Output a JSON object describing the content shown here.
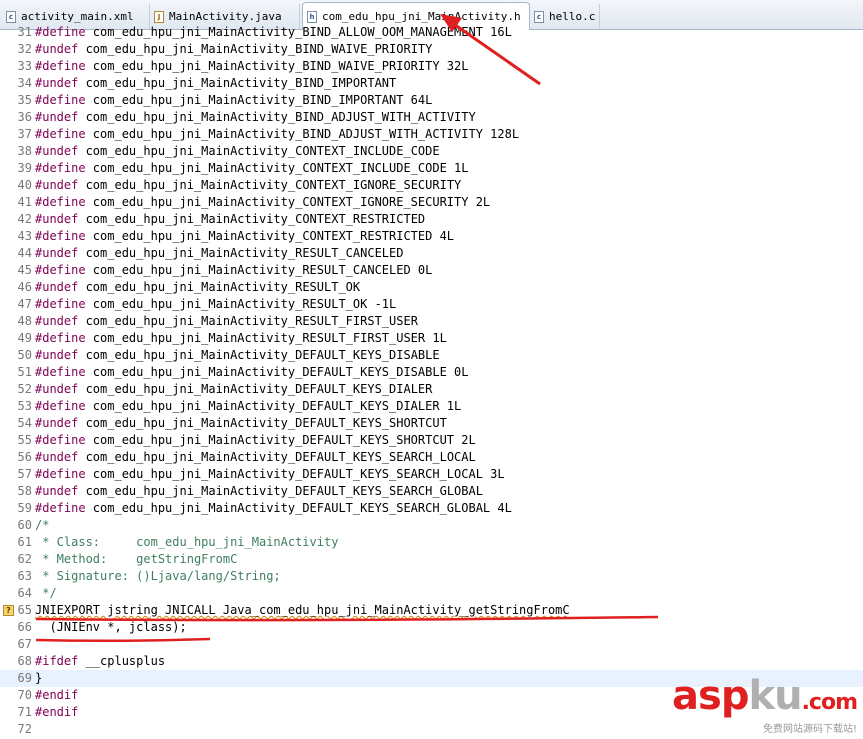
{
  "tabs": [
    {
      "label": "activity_main.xml",
      "icon": "c-file-icon"
    },
    {
      "label": "MainActivity.java",
      "icon": "java-file-icon"
    },
    {
      "label": "com_edu_hpu_jni_MainActivity.h",
      "icon": "h-file-icon",
      "active": true,
      "close": "×"
    },
    {
      "label": "hello.c",
      "icon": "c-file-icon"
    }
  ],
  "lines": [
    {
      "n": "31",
      "kw": "#define",
      "rest": " com_edu_hpu_jni_MainActivity_BIND_ALLOW_OOM_MANAGEMENT 16L"
    },
    {
      "n": "32",
      "kw": "#undef",
      "rest": " com_edu_hpu_jni_MainActivity_BIND_WAIVE_PRIORITY"
    },
    {
      "n": "33",
      "kw": "#define",
      "rest": " com_edu_hpu_jni_MainActivity_BIND_WAIVE_PRIORITY 32L"
    },
    {
      "n": "34",
      "kw": "#undef",
      "rest": " com_edu_hpu_jni_MainActivity_BIND_IMPORTANT"
    },
    {
      "n": "35",
      "kw": "#define",
      "rest": " com_edu_hpu_jni_MainActivity_BIND_IMPORTANT 64L"
    },
    {
      "n": "36",
      "kw": "#undef",
      "rest": " com_edu_hpu_jni_MainActivity_BIND_ADJUST_WITH_ACTIVITY"
    },
    {
      "n": "37",
      "kw": "#define",
      "rest": " com_edu_hpu_jni_MainActivity_BIND_ADJUST_WITH_ACTIVITY 128L"
    },
    {
      "n": "38",
      "kw": "#undef",
      "rest": " com_edu_hpu_jni_MainActivity_CONTEXT_INCLUDE_CODE"
    },
    {
      "n": "39",
      "kw": "#define",
      "rest": " com_edu_hpu_jni_MainActivity_CONTEXT_INCLUDE_CODE 1L"
    },
    {
      "n": "40",
      "kw": "#undef",
      "rest": " com_edu_hpu_jni_MainActivity_CONTEXT_IGNORE_SECURITY"
    },
    {
      "n": "41",
      "kw": "#define",
      "rest": " com_edu_hpu_jni_MainActivity_CONTEXT_IGNORE_SECURITY 2L"
    },
    {
      "n": "42",
      "kw": "#undef",
      "rest": " com_edu_hpu_jni_MainActivity_CONTEXT_RESTRICTED"
    },
    {
      "n": "43",
      "kw": "#define",
      "rest": " com_edu_hpu_jni_MainActivity_CONTEXT_RESTRICTED 4L"
    },
    {
      "n": "44",
      "kw": "#undef",
      "rest": " com_edu_hpu_jni_MainActivity_RESULT_CANCELED"
    },
    {
      "n": "45",
      "kw": "#define",
      "rest": " com_edu_hpu_jni_MainActivity_RESULT_CANCELED 0L"
    },
    {
      "n": "46",
      "kw": "#undef",
      "rest": " com_edu_hpu_jni_MainActivity_RESULT_OK"
    },
    {
      "n": "47",
      "kw": "#define",
      "rest": " com_edu_hpu_jni_MainActivity_RESULT_OK -1L"
    },
    {
      "n": "48",
      "kw": "#undef",
      "rest": " com_edu_hpu_jni_MainActivity_RESULT_FIRST_USER"
    },
    {
      "n": "49",
      "kw": "#define",
      "rest": " com_edu_hpu_jni_MainActivity_RESULT_FIRST_USER 1L"
    },
    {
      "n": "50",
      "kw": "#undef",
      "rest": " com_edu_hpu_jni_MainActivity_DEFAULT_KEYS_DISABLE"
    },
    {
      "n": "51",
      "kw": "#define",
      "rest": " com_edu_hpu_jni_MainActivity_DEFAULT_KEYS_DISABLE 0L"
    },
    {
      "n": "52",
      "kw": "#undef",
      "rest": " com_edu_hpu_jni_MainActivity_DEFAULT_KEYS_DIALER"
    },
    {
      "n": "53",
      "kw": "#define",
      "rest": " com_edu_hpu_jni_MainActivity_DEFAULT_KEYS_DIALER 1L"
    },
    {
      "n": "54",
      "kw": "#undef",
      "rest": " com_edu_hpu_jni_MainActivity_DEFAULT_KEYS_SHORTCUT"
    },
    {
      "n": "55",
      "kw": "#define",
      "rest": " com_edu_hpu_jni_MainActivity_DEFAULT_KEYS_SHORTCUT 2L"
    },
    {
      "n": "56",
      "kw": "#undef",
      "rest": " com_edu_hpu_jni_MainActivity_DEFAULT_KEYS_SEARCH_LOCAL"
    },
    {
      "n": "57",
      "kw": "#define",
      "rest": " com_edu_hpu_jni_MainActivity_DEFAULT_KEYS_SEARCH_LOCAL 3L"
    },
    {
      "n": "58",
      "kw": "#undef",
      "rest": " com_edu_hpu_jni_MainActivity_DEFAULT_KEYS_SEARCH_GLOBAL"
    },
    {
      "n": "59",
      "kw": "#define",
      "rest": " com_edu_hpu_jni_MainActivity_DEFAULT_KEYS_SEARCH_GLOBAL 4L"
    },
    {
      "n": "60",
      "cm": "/*"
    },
    {
      "n": "61",
      "cm": " * Class:     com_edu_hpu_jni_MainActivity"
    },
    {
      "n": "62",
      "cm": " * Method:    getStringFromC"
    },
    {
      "n": "63",
      "cm": " * Signature: ()Ljava/lang/String;"
    },
    {
      "n": "64",
      "cm": " */"
    },
    {
      "n": "65",
      "plain": "JNIEXPORT jstring JNICALL Java_com_edu_hpu_jni_MainActivity_getStringFromC",
      "marker": "?"
    },
    {
      "n": "66",
      "plain": "  (JNIEnv *, jclass);"
    },
    {
      "n": "67",
      "plain": ""
    },
    {
      "n": "68",
      "kw": "#ifdef",
      "rest": " __cplusplus"
    },
    {
      "n": "69",
      "plain": "}",
      "highlight": true
    },
    {
      "n": "70",
      "kw": "#endif",
      "rest": ""
    },
    {
      "n": "71",
      "kw": "#endif",
      "rest": ""
    },
    {
      "n": "72",
      "plain": ""
    }
  ],
  "watermark": {
    "asp": "asp",
    "ku": "ku",
    "com": ".com",
    "sub": "免费网站源码下载站!"
  },
  "colors": {
    "keyword": "#7f0055",
    "comment": "#3f7f5f",
    "annotation_red": "#e02020"
  }
}
